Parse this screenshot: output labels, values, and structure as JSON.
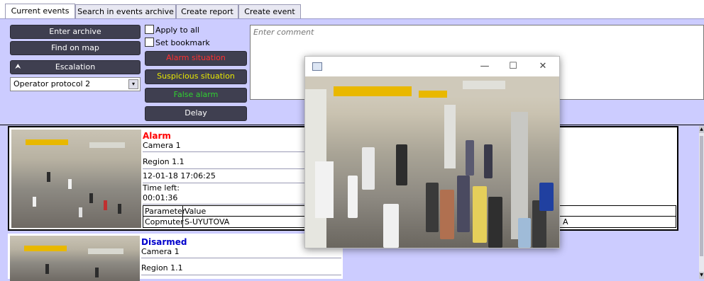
{
  "tabs": [
    {
      "label": "Current events"
    },
    {
      "label": "Search in events archive"
    },
    {
      "label": "Create report"
    },
    {
      "label": "Create event"
    }
  ],
  "controls": {
    "enter_archive": "Enter archive",
    "find_on_map": "Find on map",
    "escalation": "Escalation",
    "operator_protocol": "Operator protocol 2",
    "apply_to_all": "Apply to all",
    "set_bookmark": "Set bookmark",
    "alarm_situation": "Alarm situation",
    "suspicious_situation": "Suspicious situation",
    "false_alarm": "False alarm",
    "delay": "Delay",
    "comment_placeholder": "Enter comment"
  },
  "colors": {
    "alarm_text": "#ff3030",
    "suspicious_text": "#e8e800",
    "false_alarm_text": "#30d030",
    "alarm_status": "#ff0000",
    "disarmed_status": "#0000cc"
  },
  "events": [
    {
      "status": "Alarm",
      "camera": "Camera 1",
      "region": "Region 1.1",
      "datetime": "12-01-18 17:06:25",
      "time_left_label": "Time left:",
      "time_left": "00:01:36",
      "table_headers": [
        "Parameter",
        "Value"
      ],
      "table_rows": [
        [
          "Copmuter",
          "S-UYUTOVA"
        ]
      ],
      "overflow_fragment": "A"
    },
    {
      "status": "Disarmed",
      "camera": "Camera 1",
      "region": "Region 1.1"
    }
  ],
  "popup": {
    "window_icon": "video-window-icon",
    "minimize": "—",
    "maximize": "☐",
    "close": "✕"
  }
}
